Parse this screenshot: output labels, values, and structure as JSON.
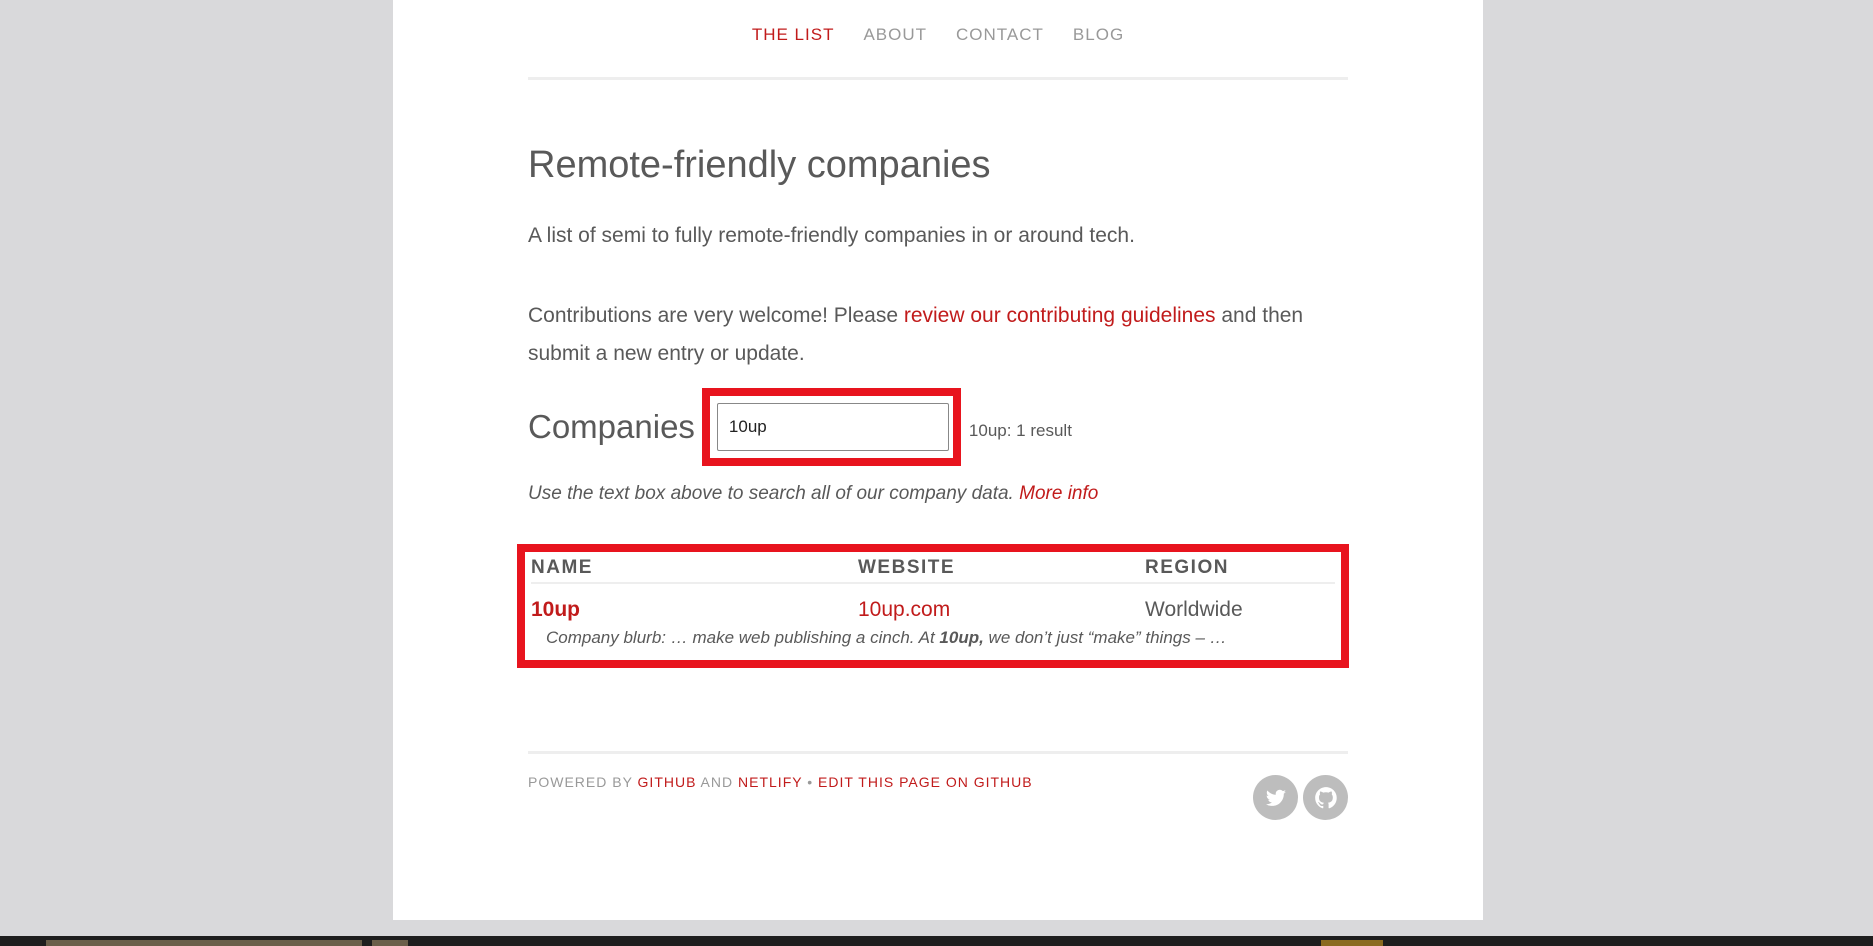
{
  "nav": {
    "items": [
      {
        "label": "THE LIST",
        "active": true
      },
      {
        "label": "ABOUT",
        "active": false
      },
      {
        "label": "CONTACT",
        "active": false
      },
      {
        "label": "BLOG",
        "active": false
      }
    ]
  },
  "page": {
    "title": "Remote-friendly companies",
    "intro": "A list of semi to fully remote-friendly companies in or around tech.",
    "contrib_before": "Contributions are very welcome! Please ",
    "contrib_link": "review our contributing guidelines",
    "contrib_after": " and then submit a new entry or update."
  },
  "companies": {
    "heading": "Companies",
    "search_value": "10up",
    "result_count": "10up: 1 result",
    "help_text": "Use the text box above to search all of our company data. ",
    "help_link": "More info"
  },
  "table": {
    "headers": {
      "name": "NAME",
      "website": "WEBSITE",
      "region": "REGION"
    },
    "rows": [
      {
        "name": "10up",
        "website": "10up.com",
        "region": "Worldwide",
        "blurb_before": "Company blurb: … make web publishing a cinch. At ",
        "blurb_bold": "10up,",
        "blurb_after": " we don’t just “make” things – …"
      }
    ]
  },
  "footer": {
    "powered_by": "POWERED BY ",
    "github": "GITHUB",
    "and": " AND ",
    "netlify": "NETLIFY",
    "bullet": " • ",
    "edit": "EDIT THIS PAGE ON GITHUB",
    "social": [
      {
        "icon": "twitter-icon"
      },
      {
        "icon": "github-icon"
      }
    ]
  },
  "colors": {
    "accent": "#c11b1b",
    "highlight": "#e8141e",
    "text": "#595959",
    "muted": "#999999",
    "background": "#d9d9db"
  }
}
